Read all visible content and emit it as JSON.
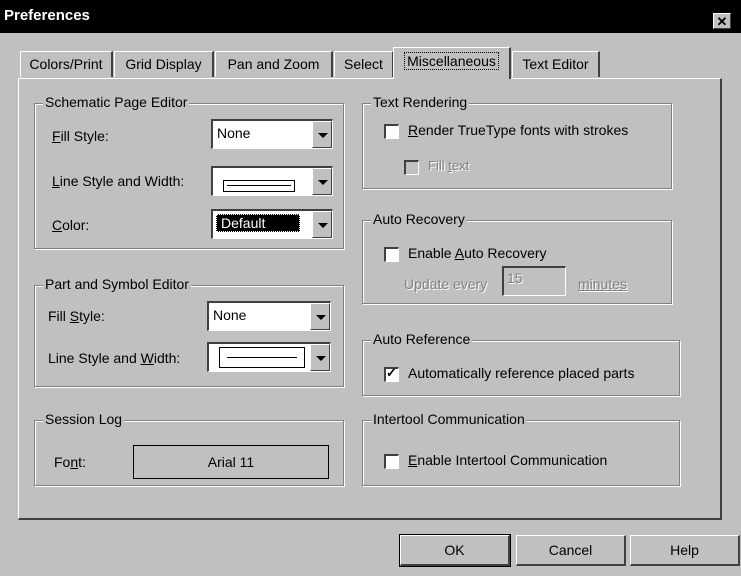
{
  "window": {
    "title": "Preferences",
    "close_glyph": "✕"
  },
  "tabs": [
    {
      "label": "Colors/Print"
    },
    {
      "label": "Grid Display"
    },
    {
      "label": "Pan and Zoom"
    },
    {
      "label": "Select"
    },
    {
      "label": "Miscellaneous",
      "active": true
    },
    {
      "label": "Text Editor"
    }
  ],
  "schematic": {
    "title": "Schematic Page Editor",
    "fill_style_pre": "",
    "fill_style_key": "F",
    "fill_style_post": "ill Style:",
    "fill_style_value": "None",
    "line_style_pre": "",
    "line_style_key": "L",
    "line_style_post": "ine Style and Width:",
    "color_pre": "",
    "color_key": "C",
    "color_post": "olor:",
    "color_value": "Default"
  },
  "part_symbol": {
    "title": "Part and Symbol Editor",
    "fill_style_pre": "Fill ",
    "fill_style_key": "S",
    "fill_style_post": "tyle:",
    "fill_style_value": "None",
    "line_style_pre": "Line Style and ",
    "line_style_key": "W",
    "line_style_post": "idth:"
  },
  "session_log": {
    "title": "Session Log",
    "font_pre": "Fo",
    "font_key": "n",
    "font_post": "t:",
    "font_value": "Arial 11"
  },
  "text_rendering": {
    "title": "Text Rendering",
    "render_pre": "",
    "render_key": "R",
    "render_post": "ender TrueType fonts with strokes",
    "render_checked": false,
    "fill_pre": "Fill ",
    "fill_key": "t",
    "fill_post": "ext",
    "fill_checked": false
  },
  "auto_recovery": {
    "title": "Auto Recovery",
    "enable_pre": "Enable ",
    "enable_key": "A",
    "enable_post": "uto Recovery",
    "enable_checked": false,
    "update_label": "Update every",
    "update_value": "15",
    "minutes_label": "minutes"
  },
  "auto_reference": {
    "title": "Auto Reference",
    "label": "Automatically reference placed parts",
    "checked": true
  },
  "intertool": {
    "title": "Intertool Communication",
    "enable_pre": "",
    "enable_key": "E",
    "enable_post": "nable Intertool Communication",
    "checked": false
  },
  "buttons": {
    "ok": "OK",
    "cancel": "Cancel",
    "help": "Help"
  },
  "glyphs": {
    "check": "✓"
  }
}
